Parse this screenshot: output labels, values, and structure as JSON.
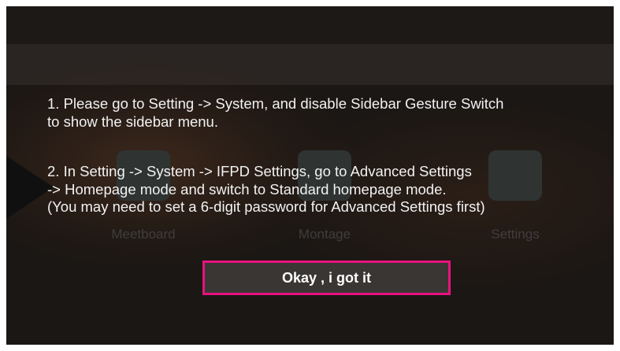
{
  "background": {
    "apps": [
      {
        "label": "Meetboard"
      },
      {
        "label": "Montage"
      },
      {
        "label": "Settings"
      }
    ]
  },
  "dialog": {
    "step1_line1": "1. Please go to Setting -> System, and disable Sidebar Gesture Switch",
    "step1_line2": "to show the sidebar menu.",
    "step2_line1": "2. In Setting -> System -> IFPD Settings, go to Advanced Settings",
    "step2_line2": "-> Homepage mode and switch to Standard homepage mode.",
    "step2_line3": "(You may need to set a 6-digit password for Advanced Settings first)",
    "ok_button": "Okay , i got it"
  },
  "colors": {
    "highlight": "#e8127e",
    "overlay_text": "#f2f2f2",
    "button_bg": "#3a3634"
  }
}
